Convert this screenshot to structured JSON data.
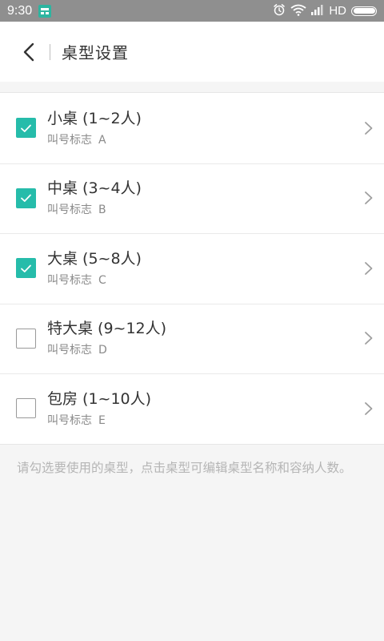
{
  "status_bar": {
    "time": "9:30",
    "network": "HD",
    "icons": [
      "app-notification-icon",
      "alarm-icon",
      "wifi-icon",
      "signal-icon",
      "battery-icon"
    ]
  },
  "header": {
    "back_icon": "chevron-left-icon",
    "title": "桌型设置"
  },
  "table_types": [
    {
      "name": "小桌 (1~2人)",
      "sub_label": "叫号标志",
      "code": "A",
      "checked": true
    },
    {
      "name": "中桌 (3~4人)",
      "sub_label": "叫号标志",
      "code": "B",
      "checked": true
    },
    {
      "name": "大桌 (5~8人)",
      "sub_label": "叫号标志",
      "code": "C",
      "checked": true
    },
    {
      "name": "特大桌 (9~12人)",
      "sub_label": "叫号标志",
      "code": "D",
      "checked": false
    },
    {
      "name": "包房 (1~10人)",
      "sub_label": "叫号标志",
      "code": "E",
      "checked": false
    }
  ],
  "hint": "请勾选要使用的桌型，点击桌型可编辑桌型名称和容纳人数。",
  "colors": {
    "accent": "#26bcaa",
    "status_bar": "#8f8f8f",
    "background": "#f5f5f5"
  }
}
